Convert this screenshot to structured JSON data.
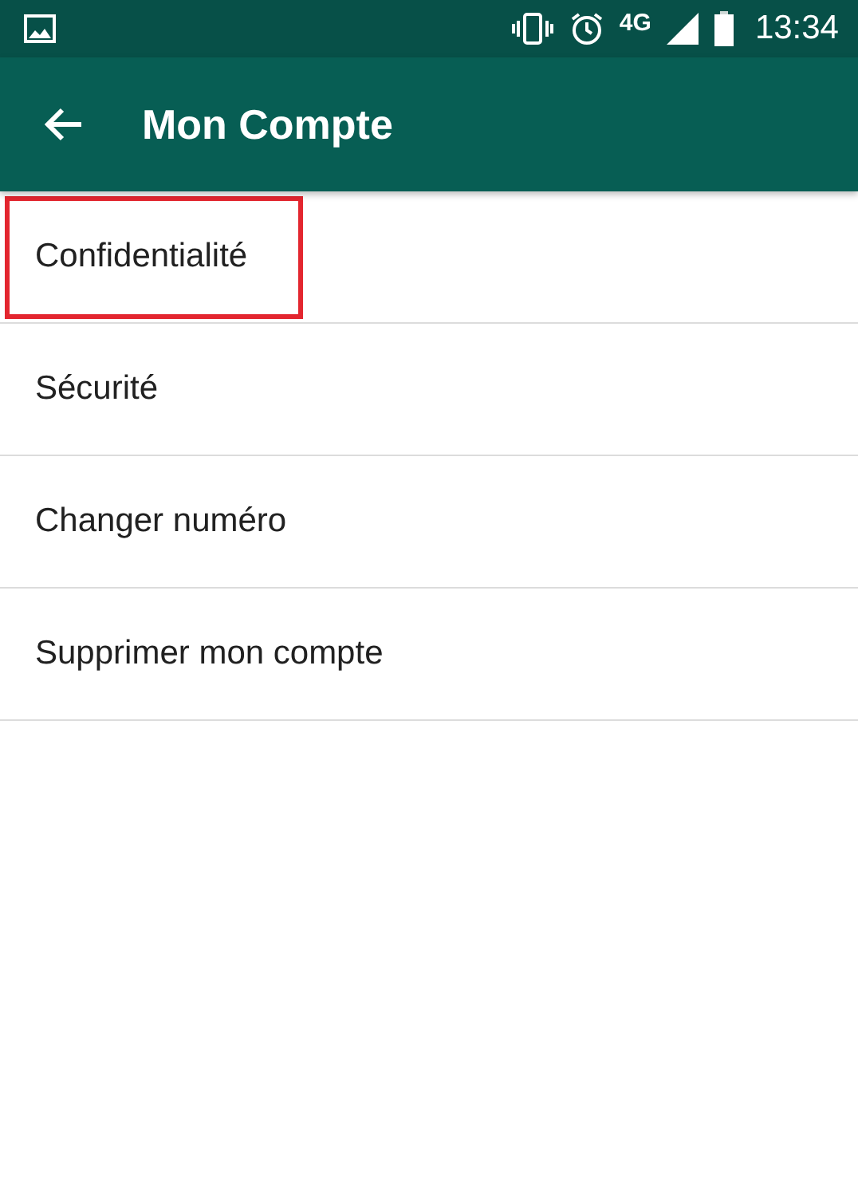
{
  "status_bar": {
    "network": "4G",
    "time": "13:34"
  },
  "app_bar": {
    "title": "Mon Compte"
  },
  "items": [
    {
      "label": "Confidentialité",
      "highlighted": true
    },
    {
      "label": "Sécurité",
      "highlighted": false
    },
    {
      "label": "Changer numéro",
      "highlighted": false
    },
    {
      "label": "Supprimer mon compte",
      "highlighted": false
    }
  ]
}
